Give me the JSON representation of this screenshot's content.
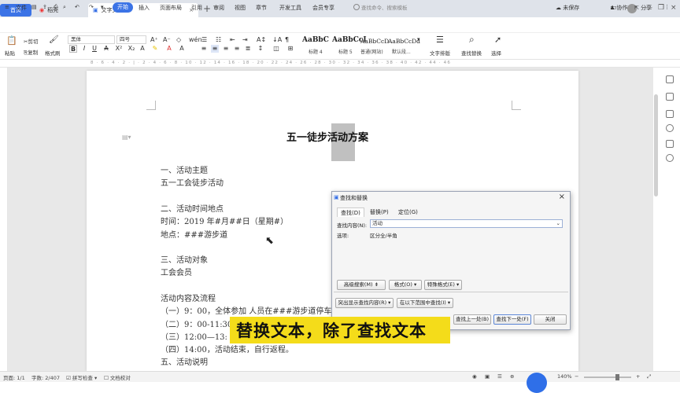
{
  "tabs": {
    "home": "首页",
    "draft": "稻壳",
    "doc": "文字文稿1"
  },
  "menu": {
    "file": "文件",
    "items": [
      "开始",
      "插入",
      "页面布局",
      "引用",
      "审阅",
      "视图",
      "章节",
      "开发工具",
      "会员专享"
    ],
    "search": "查找命令、搜索模板",
    "unsaved": "未保存",
    "collab": "协作",
    "share": "分享"
  },
  "ribbon": {
    "paste": "粘贴",
    "cut": "剪切",
    "copy": "复制",
    "format_painter": "格式刷",
    "font": "黑体",
    "size": "四号",
    "styles": [
      {
        "sample": "AaBbC",
        "label": "标题 4"
      },
      {
        "sample": "AaBbCcI",
        "label": "标题 5"
      },
      {
        "sample": "AaBbCcD",
        "label": "普通(网站)"
      },
      {
        "sample": "AaBbCcDd",
        "label": "默认段..."
      }
    ],
    "text_layout": "文字排版",
    "find_replace": "查找替换",
    "select": "选择"
  },
  "ruler": {
    "marks": "8 · 6 · 4 · 2 · | · 2 · 4 · 6 · 8 · 10 · 12 · 14 · 16 · 18 · 20 · 22 · 24 · 26 · 28 · 30 · 32 · 34 · 36 · 38 · 40 · 42 · 44 · 46"
  },
  "document": {
    "title": "五一徒步活动方案",
    "lines": [
      "一、活动主题",
      "五一工会徒步活动",
      "二、活动时间地点",
      "时间：2019 年#月##日（星期#）",
      "地点：###游步道",
      "三、活动对象",
      "工会会员",
      "活动内容及流程",
      "（一）9：00，全体参加    人员在###游步道停车场集合",
      "（二）9：00-11:30",
      "（三）12:00—13:",
      "（四）14:00，活动结束，自行返程。",
      "五、活动说明"
    ]
  },
  "dialog": {
    "title": "查找和替换",
    "tabs": [
      "查找(D)",
      "替换(P)",
      "定位(G)"
    ],
    "find_label": "查找内容(N):",
    "find_value": "活动",
    "options_label": "选项:",
    "options_value": "区分全/半角",
    "buttons": {
      "advanced": "高级搜索(M) ⇟",
      "format": "格式(O) ▾",
      "special": "特殊格式(E) ▾",
      "highlight": "突出显示查找内容(R) ▾",
      "in_range": "在以下范围中查找(I) ▾",
      "prev": "查找上一处(B)",
      "next": "查找下一处(F)",
      "close": "关闭"
    }
  },
  "subtitle": "替换文本，除了查找文本",
  "status": {
    "page": "页面: 1/1",
    "words": "字数: 2/407",
    "spell": "拼写检查 ▾",
    "proof": "文档校对",
    "zoom": "140%"
  }
}
